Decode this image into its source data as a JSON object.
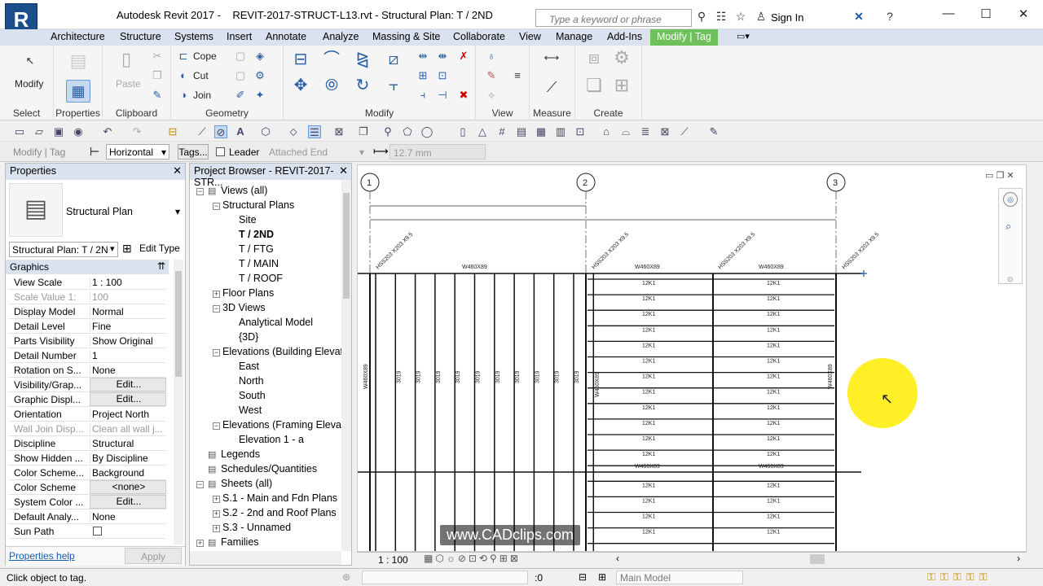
{
  "window": {
    "app_title": "Autodesk Revit 2017 -",
    "doc_title": "REVIT-2017-STRUCT-L13.rvt - Structural Plan: T / 2ND",
    "app_letter": "R",
    "search_placeholder": "Type a keyword or phrase",
    "sign_in": "Sign In",
    "min": "—",
    "max": "☐",
    "close": "✕"
  },
  "menu": {
    "items": [
      "Architecture",
      "Structure",
      "Systems",
      "Insert",
      "Annotate",
      "Analyze",
      "Massing & Site",
      "Collaborate",
      "View",
      "Manage",
      "Add-Ins"
    ],
    "active": "Modify | Tag"
  },
  "ribbon": {
    "modify": "Modify",
    "paste": "Paste",
    "cope": "Cope",
    "cut": "Cut",
    "join": "Join",
    "panels": [
      "Select",
      "Properties",
      "Clipboard",
      "Geometry",
      "Modify",
      "View",
      "Measure",
      "Create"
    ]
  },
  "options_bar": {
    "context": "Modify | Tag",
    "orientation": "Horizontal",
    "tags_btn": "Tags...",
    "leader_label": "Leader",
    "attached": "Attached End",
    "length": "12.7 mm"
  },
  "properties": {
    "title": "Properties",
    "type_name": "Structural Plan",
    "selector": "Structural Plan: T / 2N",
    "edit_type": "Edit Type",
    "section": "Graphics",
    "rows": [
      {
        "k": "View Scale",
        "v": "1 : 100"
      },
      {
        "k": "Scale Value   1:",
        "v": "100"
      },
      {
        "k": "Display Model",
        "v": "Normal"
      },
      {
        "k": "Detail Level",
        "v": "Fine"
      },
      {
        "k": "Parts Visibility",
        "v": "Show Original"
      },
      {
        "k": "Detail Number",
        "v": "1"
      },
      {
        "k": "Rotation on S...",
        "v": "None"
      },
      {
        "k": "Visibility/Grap...",
        "v": "Edit..."
      },
      {
        "k": "Graphic Displ...",
        "v": "Edit..."
      },
      {
        "k": "Orientation",
        "v": "Project North"
      },
      {
        "k": "Wall Join Disp...",
        "v": "Clean all wall j..."
      },
      {
        "k": "Discipline",
        "v": "Structural"
      },
      {
        "k": "Show Hidden ...",
        "v": "By Discipline"
      },
      {
        "k": "Color Scheme...",
        "v": "Background"
      },
      {
        "k": "Color Scheme",
        "v": "<none>"
      },
      {
        "k": "System Color ...",
        "v": "Edit..."
      },
      {
        "k": "Default Analy...",
        "v": "None"
      },
      {
        "k": "Sun Path",
        "v": ""
      }
    ],
    "help": "Properties help",
    "apply": "Apply"
  },
  "browser": {
    "title": "Project Browser - REVIT-2017-STR...",
    "items": [
      {
        "label": "Views (all)",
        "indent": 0,
        "tog": "-",
        "bold": false
      },
      {
        "label": "Structural Plans",
        "indent": 1,
        "tog": "-",
        "bold": false
      },
      {
        "label": "Site",
        "indent": 2,
        "tog": "",
        "bold": false
      },
      {
        "label": "T / 2ND",
        "indent": 2,
        "tog": "",
        "bold": true
      },
      {
        "label": "T / FTG",
        "indent": 2,
        "tog": "",
        "bold": false
      },
      {
        "label": "T / MAIN",
        "indent": 2,
        "tog": "",
        "bold": false
      },
      {
        "label": "T / ROOF",
        "indent": 2,
        "tog": "",
        "bold": false
      },
      {
        "label": "Floor Plans",
        "indent": 1,
        "tog": "+",
        "bold": false
      },
      {
        "label": "3D Views",
        "indent": 1,
        "tog": "-",
        "bold": false
      },
      {
        "label": "Analytical Model",
        "indent": 2,
        "tog": "",
        "bold": false
      },
      {
        "label": "{3D}",
        "indent": 2,
        "tog": "",
        "bold": false
      },
      {
        "label": "Elevations (Building Elevat",
        "indent": 1,
        "tog": "-",
        "bold": false
      },
      {
        "label": "East",
        "indent": 2,
        "tog": "",
        "bold": false
      },
      {
        "label": "North",
        "indent": 2,
        "tog": "",
        "bold": false
      },
      {
        "label": "South",
        "indent": 2,
        "tog": "",
        "bold": false
      },
      {
        "label": "West",
        "indent": 2,
        "tog": "",
        "bold": false
      },
      {
        "label": "Elevations (Framing Elevat",
        "indent": 1,
        "tog": "-",
        "bold": false
      },
      {
        "label": "Elevation 1 - a",
        "indent": 2,
        "tog": "",
        "bold": false
      },
      {
        "label": "Legends",
        "indent": 0,
        "tog": "",
        "bold": false
      },
      {
        "label": "Schedules/Quantities",
        "indent": 0,
        "tog": "",
        "bold": false
      },
      {
        "label": "Sheets (all)",
        "indent": 0,
        "tog": "-",
        "bold": false
      },
      {
        "label": "S.1 - Main and Fdn Plans",
        "indent": 1,
        "tog": "+",
        "bold": false
      },
      {
        "label": "S.2 - 2nd and Roof Plans",
        "indent": 1,
        "tog": "+",
        "bold": false
      },
      {
        "label": "S.3 - Unnamed",
        "indent": 1,
        "tog": "+",
        "bold": false
      },
      {
        "label": "Families",
        "indent": 0,
        "tog": "+",
        "bold": false
      }
    ]
  },
  "drawing": {
    "grids": [
      "1",
      "2",
      "3"
    ],
    "beam_label": "W460X89",
    "joist_label": "12K1",
    "joist_small": "3019",
    "brace_label": "HSS203 X203 X9.5"
  },
  "viewbar": {
    "scale": "1 : 100"
  },
  "status": {
    "hint": "Click object to tag.",
    "count": ":0",
    "model": "Main Model"
  },
  "watermark": "www.CADclips.com"
}
